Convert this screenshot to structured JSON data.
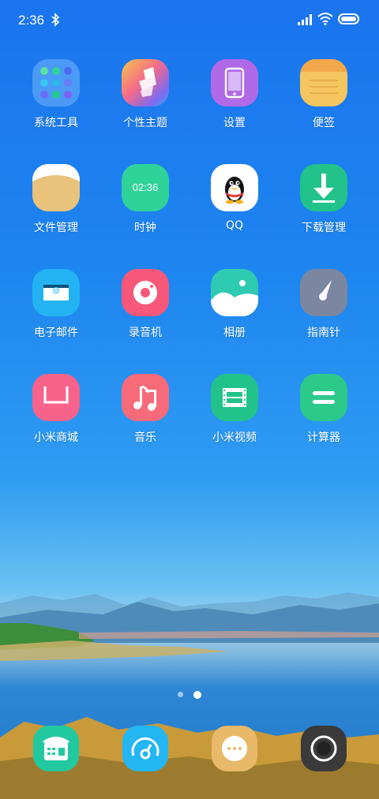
{
  "status_bar": {
    "time": "2:36",
    "icons": [
      "bluetooth-icon",
      "cellular-signal-icon",
      "wifi-icon",
      "battery-icon"
    ]
  },
  "apps": [
    {
      "label": "系统工具",
      "icon": "system-tools-folder-icon",
      "color": "#3a88f5"
    },
    {
      "label": "个性主题",
      "icon": "theme-brush-icon",
      "color": "#f56a8a"
    },
    {
      "label": "设置",
      "icon": "settings-phone-icon",
      "color": "#b06ae8"
    },
    {
      "label": "便签",
      "icon": "notes-icon",
      "color": "#f7d06b"
    },
    {
      "label": "文件管理",
      "icon": "file-manager-icon",
      "color": "#e8c27a"
    },
    {
      "label": "时钟",
      "icon": "clock-icon",
      "color": "#2fd39a",
      "icon_text": "02:36"
    },
    {
      "label": "QQ",
      "icon": "qq-penguin-icon",
      "color": "#ffffff"
    },
    {
      "label": "下载管理",
      "icon": "download-arrow-icon",
      "color": "#22c38a"
    },
    {
      "label": "电子邮件",
      "icon": "email-icon",
      "color": "#23b3f2",
      "icon_text": "@"
    },
    {
      "label": "录音机",
      "icon": "recorder-icon",
      "color": "#f7587a"
    },
    {
      "label": "相册",
      "icon": "gallery-icon",
      "color": "#2fcab2"
    },
    {
      "label": "指南针",
      "icon": "compass-icon",
      "color": "#7b86a0"
    },
    {
      "label": "小米商城",
      "icon": "mi-store-bag-icon",
      "color": "#f7638a"
    },
    {
      "label": "音乐",
      "icon": "music-note-icon",
      "color": "#f76a7a"
    },
    {
      "label": "小米视频",
      "icon": "video-film-icon",
      "color": "#22c38a"
    },
    {
      "label": "计算器",
      "icon": "calculator-icon",
      "color": "#2bc98a"
    }
  ],
  "dock": [
    {
      "icon": "phone-icon",
      "color": "#22c9a0"
    },
    {
      "icon": "browser-icon",
      "color": "#23b6f2"
    },
    {
      "icon": "messages-icon",
      "color": "#e9b96a"
    },
    {
      "icon": "camera-icon",
      "color": "#3a3a3a"
    }
  ],
  "page_indicator": {
    "pages": 2,
    "current": 2
  }
}
